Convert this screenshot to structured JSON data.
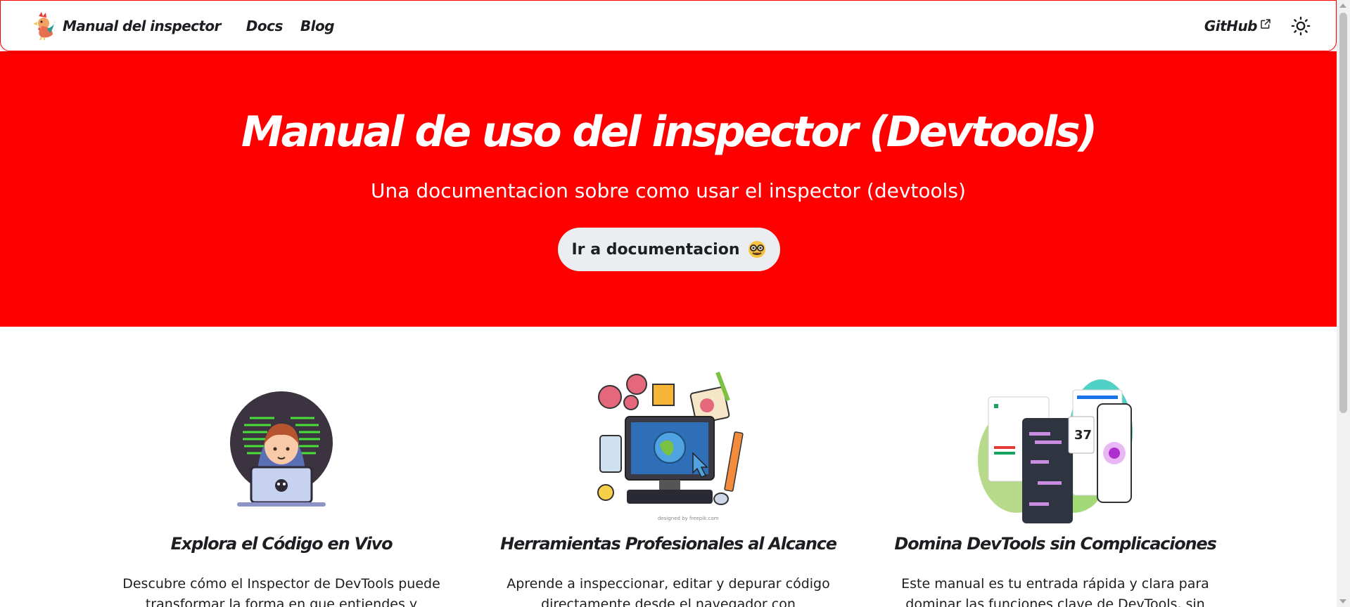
{
  "navbar": {
    "brand_title": "Manual del inspector",
    "logo_icon": "rooster-logo-icon",
    "links": [
      {
        "label": "Docs"
      },
      {
        "label": "Blog"
      }
    ],
    "github_label": "GitHub",
    "external_icon": "external-link-icon",
    "theme_icon": "sun-icon"
  },
  "hero": {
    "title": "Manual de uso del inspector (Devtools)",
    "subtitle": "Una documentacion sobre como usar el inspector (devtools)",
    "button_label": "Ir a documentacion",
    "button_icon": "nerd-face-emoji-icon",
    "background_color": "#ff0000"
  },
  "features": [
    {
      "title": "Explora el Código en Vivo",
      "description": "Descubre cómo el Inspector de DevTools puede transformar la forma en que entiendes y construyes",
      "image_icon": "hacker-laptop-illustration"
    },
    {
      "title": "Herramientas Profesionales al Alcance",
      "description": "Aprende a inspeccionar, editar y depurar código directamente desde el navegador con herramientas",
      "image_icon": "computer-tools-illustration",
      "image_credit": "designed by freepik.com"
    },
    {
      "title": "Domina DevTools sin Complicaciones",
      "description": "Este manual es tu entrada rápida y clara para dominar las funciones clave de DevTools, sin",
      "image_icon": "devtools-panels-illustration",
      "image_number": "37"
    }
  ],
  "colors": {
    "accent": "#ff0000",
    "button_bg": "#ebedf0",
    "text": "#1c1e21"
  }
}
